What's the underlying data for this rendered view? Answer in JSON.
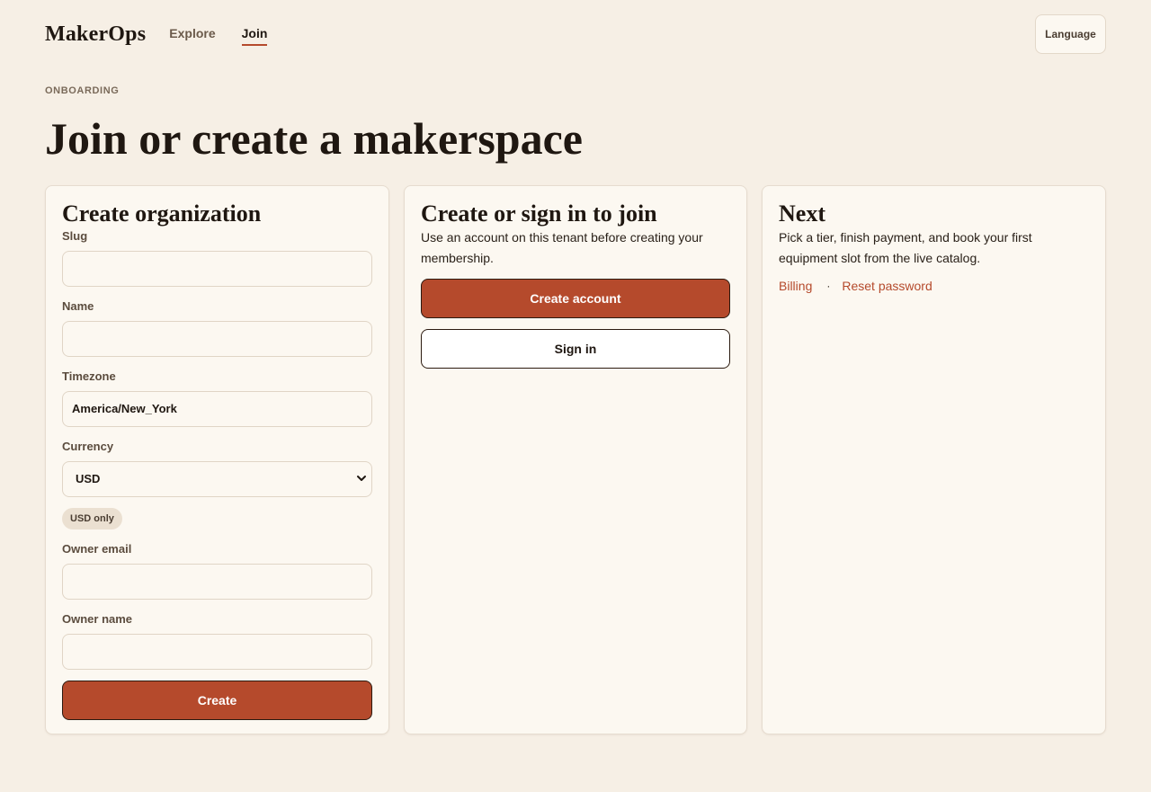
{
  "header": {
    "brand": "MakerOps",
    "nav": [
      {
        "label": "Explore",
        "active": false
      },
      {
        "label": "Join",
        "active": true
      }
    ],
    "language_button": "Language"
  },
  "page": {
    "eyebrow": "ONBOARDING",
    "title": "Join or create a makerspace"
  },
  "create_org": {
    "heading": "Create organization",
    "fields": {
      "slug": {
        "label": "Slug",
        "value": ""
      },
      "name": {
        "label": "Name",
        "value": ""
      },
      "timezone": {
        "label": "Timezone",
        "value": "America/New_York"
      },
      "currency": {
        "label": "Currency",
        "selected": "USD",
        "icon": "chevron-down-icon"
      },
      "currency_badge": "USD only",
      "owner_email": {
        "label": "Owner email",
        "value": ""
      },
      "owner_name": {
        "label": "Owner name",
        "value": ""
      }
    },
    "submit": "Create"
  },
  "join": {
    "heading": "Create or sign in to join",
    "description": "Use an account on this tenant before creating your membership.",
    "create_account": "Create account",
    "sign_in": "Sign in"
  },
  "next": {
    "heading": "Next",
    "description": "Pick a tier, finish payment, and book your first equipment slot from the live catalog.",
    "links": [
      "Billing",
      "Reset password"
    ],
    "separator": "·"
  },
  "colors": {
    "background": "#f6efe5",
    "card": "#fcf8f1",
    "accent": "#b54a2c",
    "text": "#1f1711"
  }
}
